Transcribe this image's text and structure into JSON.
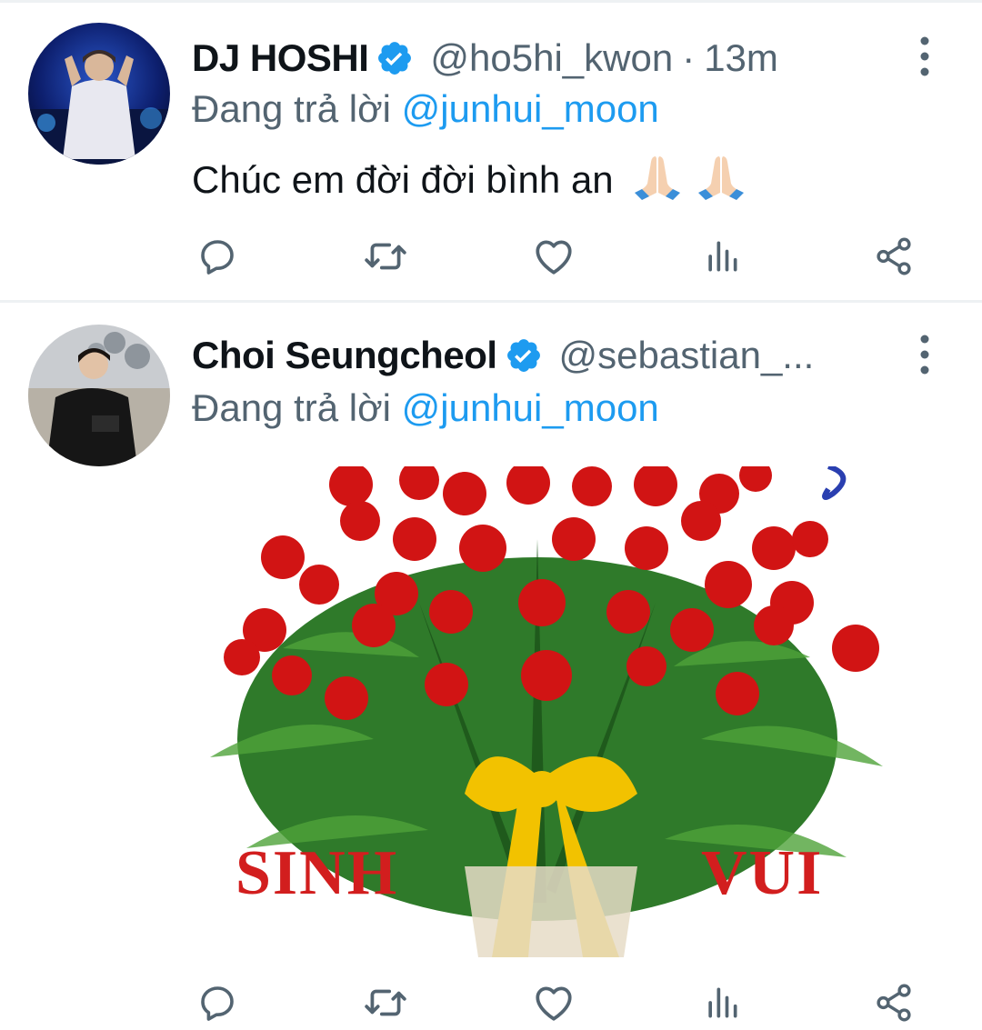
{
  "tweets": [
    {
      "author_name": "DJ HOSHI",
      "handle": "@ho5hi_kwon",
      "separator": "·",
      "time": "13m",
      "reply_prefix": "Đang trả lời",
      "reply_to": "@junhui_moon",
      "text": "Chúc em đời đời bình an",
      "emojis": [
        "folded-hands-icon",
        "folded-hands-icon"
      ]
    },
    {
      "author_name": "Choi Seungcheol",
      "handle": "@sebastian_...",
      "reply_prefix": "Đang trả lời",
      "reply_to": "@junhui_moon",
      "media": {
        "caption_left": "SINH",
        "caption_right": "VUI"
      }
    }
  ],
  "colors": {
    "accent": "#1d9bf0",
    "secondary_text": "#536471",
    "primary_text": "#0f1419",
    "divider": "#eef1f3"
  },
  "icons": [
    "reply-icon",
    "retweet-icon",
    "like-icon",
    "views-icon",
    "share-icon",
    "more-icon",
    "verified-badge-icon"
  ]
}
